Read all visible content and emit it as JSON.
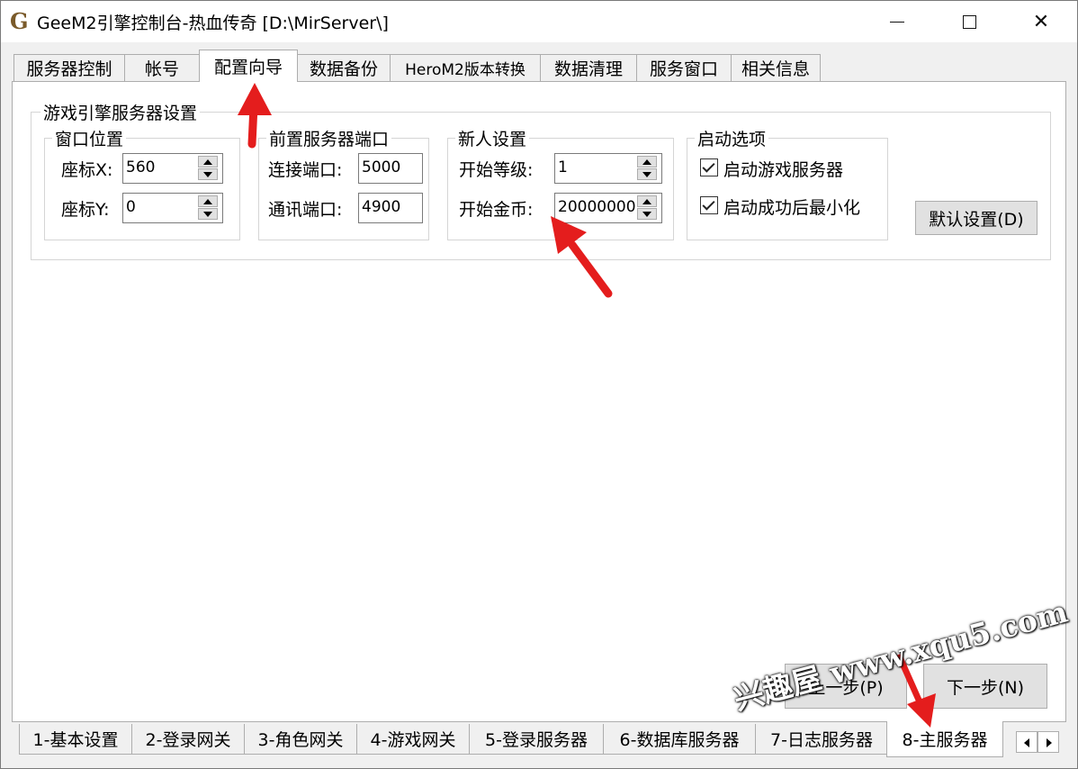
{
  "titlebar": {
    "icon_letter": "G",
    "title": "GeeM2引擎控制台-热血传奇 [D:\\MirServer\\]"
  },
  "top_tabs": [
    "服务器控制",
    "帐号",
    "配置向导",
    "数据备份",
    "HeroM2版本转换",
    "数据清理",
    "服务窗口",
    "相关信息"
  ],
  "active_top_tab": "配置向导",
  "engine_group": {
    "title": "游戏引擎服务器设置",
    "window_position": {
      "title": "窗口位置",
      "x_label": "座标X:",
      "x_value": "560",
      "y_label": "座标Y:",
      "y_value": "0"
    },
    "gateway_ports": {
      "title": "前置服务器端口",
      "connect_label": "连接端口:",
      "connect_value": "5000",
      "comm_label": "通讯端口:",
      "comm_value": "4900"
    },
    "newbie": {
      "title": "新人设置",
      "level_label": "开始等级:",
      "level_value": "1",
      "gold_label": "开始金币:",
      "gold_value": "20000000"
    },
    "startup": {
      "title": "启动选项",
      "option1": "启动游戏服务器",
      "option1_checked": true,
      "option2": "启动成功后最小化",
      "option2_checked": true
    },
    "default_button": "默认设置(D)"
  },
  "nav": {
    "prev": "上一步(P)",
    "next": "下一步(N)"
  },
  "bottom_tabs": [
    "1-基本设置",
    "2-登录网关",
    "3-角色网关",
    "4-游戏网关",
    "5-登录服务器",
    "6-数据库服务器",
    "7-日志服务器",
    "8-主服务器"
  ],
  "active_bottom_tab": "8-主服务器",
  "watermark": "兴趣屋 www.xqu5.com",
  "colors": {
    "annotation_arrow": "#e41d1d",
    "tab_border": "#adadad",
    "button_face": "#e1e1e1"
  }
}
